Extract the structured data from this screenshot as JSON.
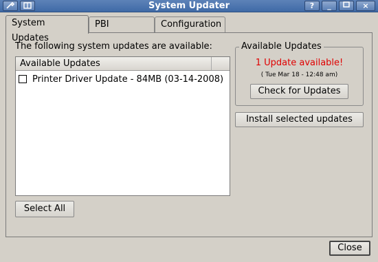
{
  "window": {
    "title": "System Updater"
  },
  "titlebar": {
    "left_buttons": [
      "wrench-icon",
      "window-menu-icon"
    ],
    "right_buttons": [
      "?",
      "_",
      "□",
      "×"
    ]
  },
  "tabs": [
    {
      "label": "System Updates",
      "active": true
    },
    {
      "label": "PBI Updates",
      "active": false
    },
    {
      "label": "Configuration",
      "active": false
    }
  ],
  "main": {
    "intro_text": "The following system updates are available:",
    "list": {
      "header": "Available Updates",
      "items": [
        {
          "label": "Printer Driver Update - 84MB (03-14-2008)",
          "checked": false
        }
      ]
    },
    "select_all_label": "Select All"
  },
  "side": {
    "group_title": "Available Updates",
    "status": "1 Update available!",
    "timestamp": "( Tue Mar 18 - 12:48 am)",
    "check_label": "Check for Updates",
    "install_label": "Install selected updates"
  },
  "footer": {
    "close_label": "Close"
  },
  "colors": {
    "status_red": "#e00000",
    "titlebar": "#4a72ad"
  }
}
